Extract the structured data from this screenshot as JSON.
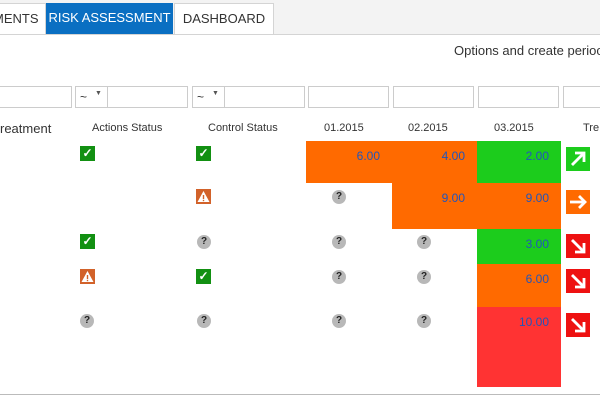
{
  "tabs": [
    {
      "label": "MENTS",
      "active": false
    },
    {
      "label": "RISK ASSESSMENT",
      "active": true
    },
    {
      "label": "DASHBOARD",
      "active": false
    }
  ],
  "options_text": "Options and create perioc",
  "filters": {
    "tilde": "~",
    "dropdown": "▼"
  },
  "columns": {
    "treatment": "reatment",
    "actions_status": "Actions Status",
    "control_status": "Control Status",
    "p1": "01.2015",
    "p2": "02.2015",
    "p3": "03.2015",
    "trend": "Tre"
  },
  "status_icons": {
    "check": "check-icon",
    "warning": "warning-icon",
    "unknown": "question-icon"
  },
  "colors": {
    "green": "#1ccc1c",
    "orange": "#ff6a00",
    "red": "#ff3333",
    "accent": "#0a6fc2"
  },
  "rows": [
    {
      "actions": "check",
      "control": "check",
      "p1_status": "",
      "p2_status": "",
      "trend": "up"
    },
    {
      "actions": "",
      "control": "warning",
      "p1_status": "?",
      "p2_status": "",
      "trend": "right"
    },
    {
      "actions": "check",
      "control": "?",
      "p1_status": "?",
      "p2_status": "?",
      "trend": "down"
    },
    {
      "actions": "warning",
      "control": "check",
      "p1_status": "?",
      "p2_status": "?",
      "trend": "down"
    },
    {
      "actions": "?",
      "control": "?",
      "p1_status": "?",
      "p2_status": "?",
      "trend": "down"
    }
  ],
  "values": {
    "r1_p1": "6.00",
    "r1_p2": "4.00",
    "r1_p3": "2.00",
    "r2_p2": "9.00",
    "r2_p3": "9.00",
    "r3_p3": "3.00",
    "r4_p3": "6.00",
    "r5_p3": "10.00"
  },
  "symbols": {
    "check": "✓",
    "question": "?"
  }
}
